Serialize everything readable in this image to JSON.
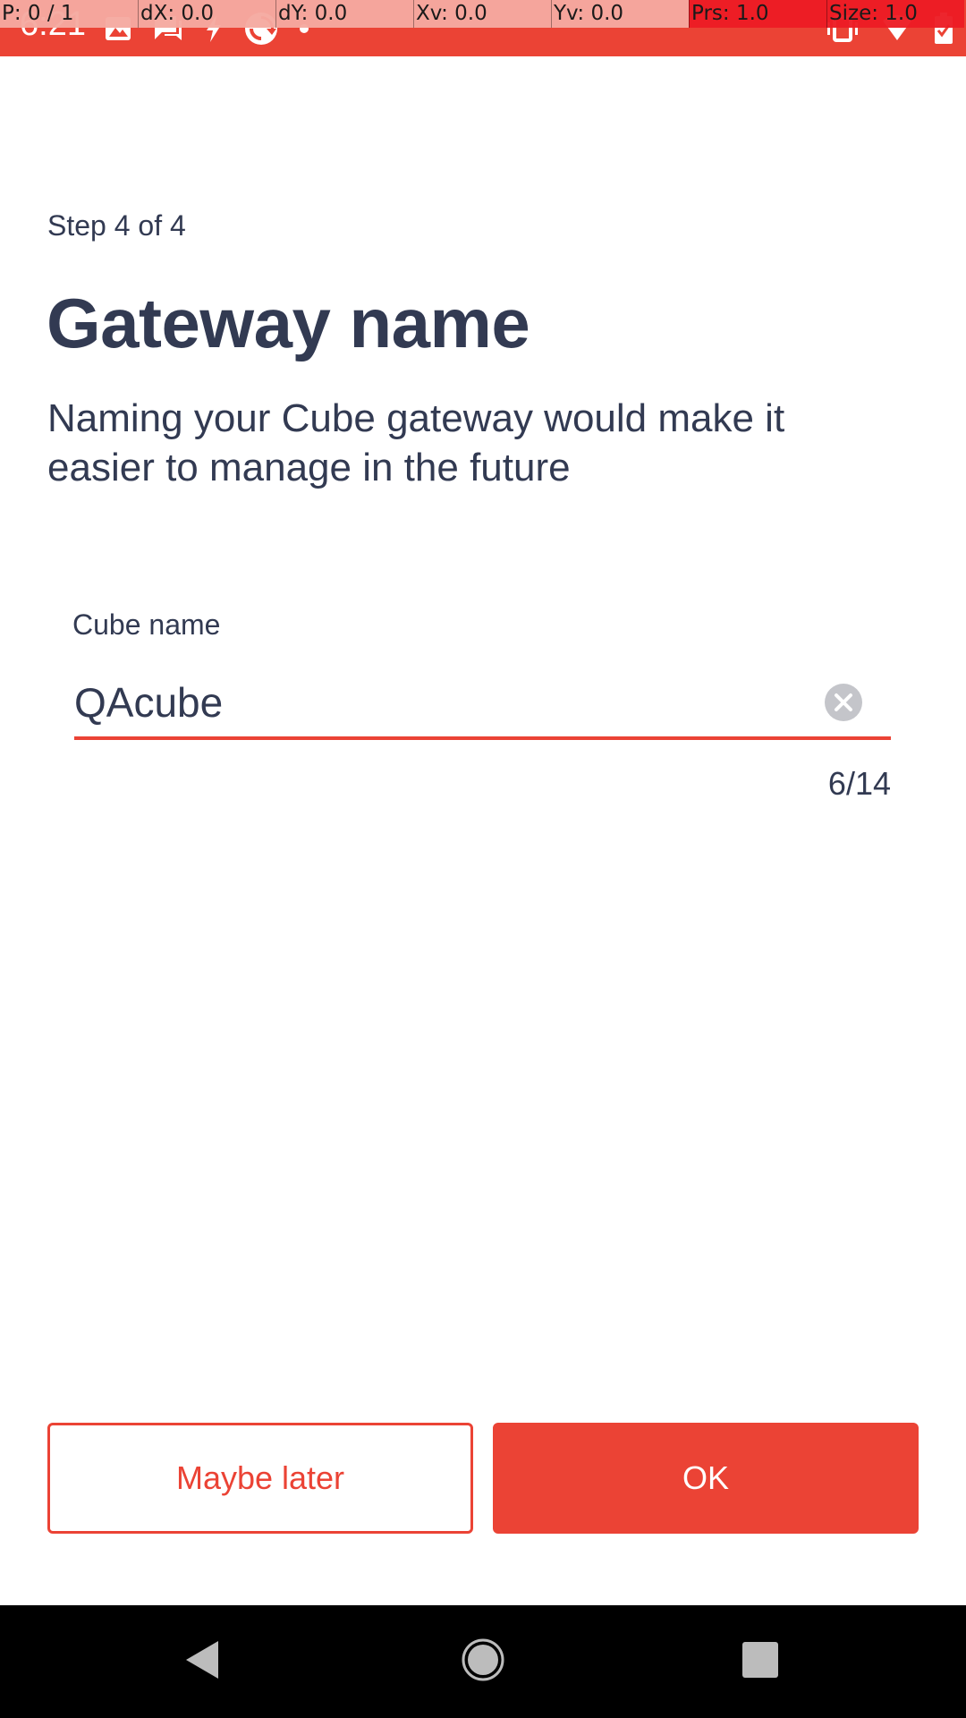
{
  "status_bar": {
    "time": "6:21",
    "background_color": "#eb4335",
    "left_icons": [
      "gallery-icon",
      "chat-icon",
      "bolt-icon",
      "sync-icon",
      "dot-icon"
    ],
    "right_icons": [
      "vibrate-icon",
      "wifi-icon",
      "battery-icon"
    ]
  },
  "pointer_overlay": {
    "cells": [
      "P: 0 / 1",
      "dX: 0.0",
      "dY: 0.0",
      "Xv: 0.0",
      "Yv: 0.0",
      "Prs: 1.0",
      "Size: 1.0"
    ]
  },
  "step": {
    "label": "Step 4 of 4"
  },
  "header": {
    "title": "Gateway name",
    "description": "Naming your Cube gateway would make it easier to manage in the future"
  },
  "form": {
    "field_label": "Cube name",
    "value": "QAcube",
    "counter": "6/14",
    "clear_icon": "clear-circle-icon",
    "accent_color": "#eb4335"
  },
  "actions": {
    "secondary_label": "Maybe later",
    "primary_label": "OK"
  },
  "nav_bar": {
    "icons": [
      "back-triangle-icon",
      "home-circle-icon",
      "recents-square-icon"
    ]
  }
}
